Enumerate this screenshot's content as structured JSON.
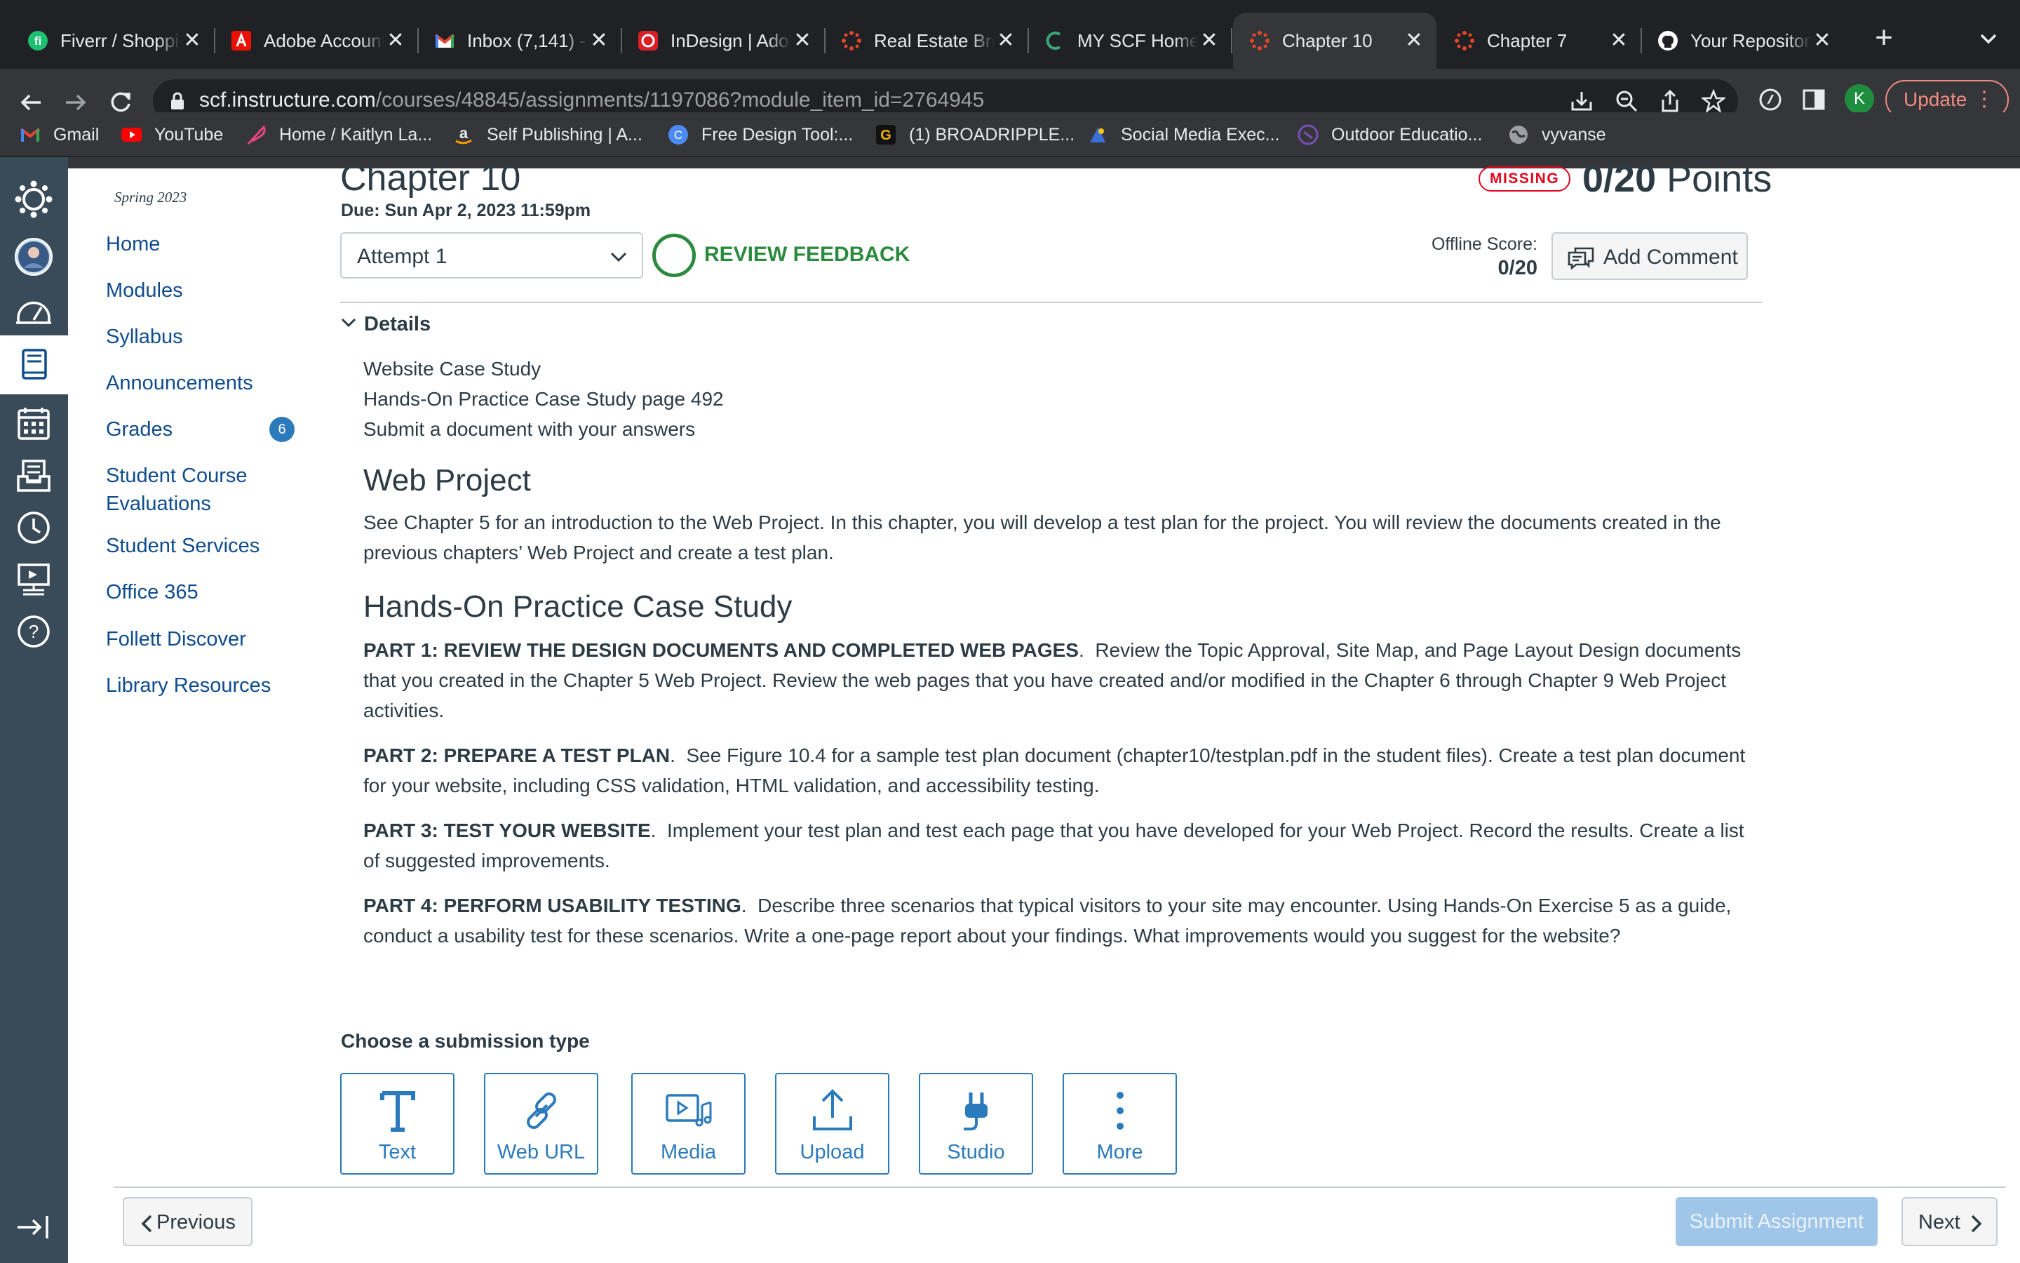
{
  "browser": {
    "tabs": [
      {
        "title": "Fiverr / Shopping",
        "icon": "fiverr-icon",
        "active": false
      },
      {
        "title": "Adobe Account",
        "icon": "adobe-icon",
        "active": false
      },
      {
        "title": "Inbox (7,141) - ",
        "icon": "gmail-icon",
        "active": false
      },
      {
        "title": "InDesign | Adobe",
        "icon": "creative-cloud-icon",
        "active": false
      },
      {
        "title": "Real Estate Brochure",
        "icon": "canvas-icon",
        "active": false
      },
      {
        "title": "MY SCF Home",
        "icon": "scf-icon",
        "active": false
      },
      {
        "title": "Chapter 10",
        "icon": "canvas-icon",
        "active": true
      },
      {
        "title": "Chapter 7",
        "icon": "canvas-icon",
        "active": false
      },
      {
        "title": "Your Repositories",
        "icon": "github-icon",
        "active": false
      }
    ],
    "url_host": "scf.instructure.com",
    "url_path": "/courses/48845/assignments/1197086?module_item_id=2764945",
    "profile_initial": "K",
    "update_label": "Update",
    "bookmarks": [
      {
        "label": "Gmail",
        "icon": "gmail-icon"
      },
      {
        "label": "YouTube",
        "icon": "youtube-icon"
      },
      {
        "label": "Home / Kaitlyn La...",
        "icon": "feather-icon"
      },
      {
        "label": "Self Publishing | A...",
        "icon": "amazon-icon"
      },
      {
        "label": "Free Design Tool:...",
        "icon": "canva-icon"
      },
      {
        "label": "(1) BROADRIPPLE...",
        "icon": "g-icon"
      },
      {
        "label": "Social Media Exec...",
        "icon": "social-icon"
      },
      {
        "label": "Outdoor Educatio...",
        "icon": "outdoor-icon"
      },
      {
        "label": "vyvanse",
        "icon": "globe-icon"
      }
    ],
    "colors": {
      "tabbar": "#202124",
      "toolbar": "#35363a",
      "accent": "#f28b82"
    }
  },
  "global_nav": {
    "items": [
      "canvas-logo-icon",
      "account-avatar-icon",
      "dashboard-icon",
      "courses-icon",
      "calendar-icon",
      "inbox-icon",
      "history-icon",
      "commons-icon",
      "help-icon"
    ],
    "collapse_icon": "collapse-nav-icon",
    "color": "#394b58"
  },
  "course_nav": {
    "term": "Spring 2023",
    "items": [
      {
        "label": "Home"
      },
      {
        "label": "Modules"
      },
      {
        "label": "Syllabus"
      },
      {
        "label": "Announcements"
      },
      {
        "label": "Grades",
        "badge": "6"
      },
      {
        "label": "Student Course Evaluations"
      },
      {
        "label": "Student Services"
      },
      {
        "label": "Office 365"
      },
      {
        "label": "Follett Discover"
      },
      {
        "label": "Library Resources"
      }
    ],
    "link_color": "#0e4c8e"
  },
  "assignment": {
    "title": "Chapter 10",
    "due": "Due: Sun Apr 2, 2023 11:59pm",
    "status_badge": "MISSING",
    "score": "0/20",
    "points_label": "Points",
    "attempt": "Attempt 1",
    "review_feedback": "REVIEW FEEDBACK",
    "offline_score_label": "Offline Score:",
    "offline_score_value": "0/20",
    "add_comment": "Add Comment",
    "details_label": "Details",
    "intro_lines": [
      "Website Case Study",
      "Hands-On Practice Case Study page 492",
      "Submit a document with your answers"
    ],
    "web_project_heading": "Web Project",
    "web_project_text": "See Chapter 5 for an introduction to the Web Project. In this chapter, you will develop a test plan for the project. You will review the documents created in the previous chapters’ Web Project and create a test plan.",
    "case_study_heading": "Hands-On Practice Case Study",
    "parts": [
      {
        "label": "PART 1: REVIEW THE DESIGN DOCUMENTS AND COMPLETED WEB PAGES",
        "text": "Review the Topic Approval, Site Map, and Page Layout Design documents that you created in the Chapter 5 Web Project. Review the web pages that you have created and/or modified in the Chapter 6 through Chapter 9 Web Project activities."
      },
      {
        "label": "PART 2: PREPARE A TEST PLAN",
        "text": "See Figure 10.4 for a sample test plan document (chapter10/testplan.pdf in the student files). Create a test plan document for your website, including CSS validation, HTML validation, and accessibility testing."
      },
      {
        "label": "PART 3: TEST YOUR WEBSITE",
        "text": "Implement your test plan and test each page that you have developed for your Web Project. Record the results. Create a list of suggested improvements."
      },
      {
        "label": "PART 4: PERFORM USABILITY TESTING",
        "text": "Describe three scenarios that typical visitors to your site may encounter. Using Hands-On Exercise 5 as a guide, conduct a usability test for these scenarios. Write a one-page report about your findings. What improvements would you suggest for the website?"
      }
    ],
    "submission_heading": "Choose a submission type",
    "submission_types": [
      {
        "label": "Text",
        "icon": "text-icon"
      },
      {
        "label": "Web URL",
        "icon": "link-icon"
      },
      {
        "label": "Media",
        "icon": "media-icon"
      },
      {
        "label": "Upload",
        "icon": "upload-icon"
      },
      {
        "label": "Studio",
        "icon": "studio-icon"
      },
      {
        "label": "More",
        "icon": "more-icon"
      }
    ],
    "colors": {
      "missing": "#e0061f",
      "review": "#2b8a3e",
      "link": "#2b7abc",
      "submit_disabled": "#9fc5e8"
    }
  },
  "footer": {
    "previous": "Previous",
    "submit": "Submit Assignment",
    "next": "Next"
  }
}
